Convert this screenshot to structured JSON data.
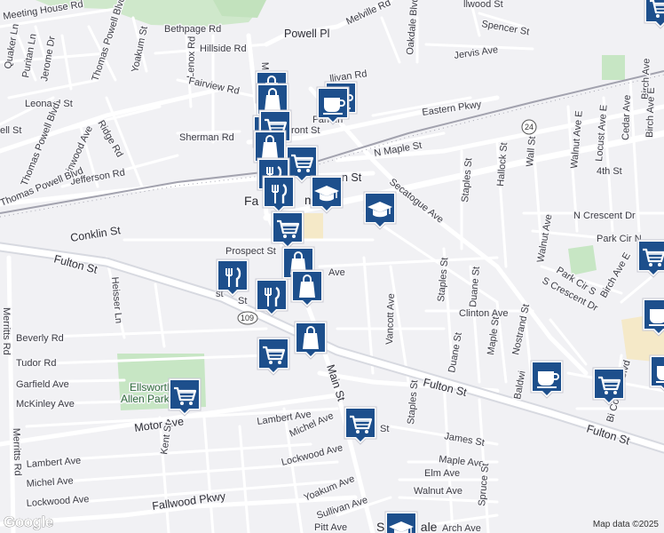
{
  "attribution": "Map data ©2025",
  "logo": "Google",
  "colors": {
    "land": "#f1f1f4",
    "road": "#ffffff",
    "major_road": "#d5d7de",
    "rail": "#9a9aa6",
    "park": "#c7e6c4",
    "marker": "#1d4f8c",
    "school_area": "#f5e9c8"
  },
  "labels": {
    "meeting_house_rd": "Meeting House Rd",
    "bethpage_rd": "Bethpage Rd",
    "powell_pl": "Powell Pl",
    "melville_rd": "Melville Rd",
    "oakdale_blvd": "Oakdale Blvd",
    "spencer_st": "Spencer St",
    "jervis_ave": "Jervis Ave",
    "fallwood_st_top": "llwood St",
    "quaker_ln": "Quaker Ln",
    "puritan_ln": "Puritan Ln",
    "jerome_dr": "Jerome Dr",
    "thomas_powell_blvd_top": "Thomas Powell Blvd",
    "yoakum_st_top": "Yoakum St",
    "lenox_rd": "Lenox Rd",
    "hillside_rd": "Hillside Rd",
    "main_top": "Main",
    "fairview_rd": "Fairview Rd",
    "sullivan_rd": "llivan Rd",
    "leonard_st": "Leonard St",
    "well_st": "ell St",
    "linwood_ave": "Linwood Ave",
    "ridge_rd": "Ridge Rd",
    "thomas_powell_blvd_left": "Thomas Powell Blvd",
    "sherman_rd": "Sherman Rd",
    "jefferson_rd": "Jefferson Rd",
    "thomas_powell_blvd_low": "Thomas Powell Blvd",
    "farmingdale_station": "Farmin",
    "front_st": "ront St",
    "eastern_pkwy": "Eastern Pkwy",
    "n_maple_st": "N Maple St",
    "route_24": "24",
    "birch_ave_top": "Birch Ave",
    "cedar_ave": "Cedar Ave",
    "walnut_ave_e": "Walnut Ave E",
    "locust_ave_e": "Locust Ave E",
    "birch_ave_e_top": "Birch Ave E",
    "fourth_st": "4th St",
    "wall_st": "Wall St",
    "hallock_st": "Hallock St",
    "staples_st_mid": "Staples St",
    "secatogue_ave": "Secatogue Ave",
    "main_st_crossing": "n St",
    "town_name": "Fa",
    "town_name_right": "ma",
    "conklin_st": "Conklin St",
    "n_crescent_dr": "N Crescent Dr",
    "park_cir_n": "Park Cir N",
    "walnut_ave": "Walnut Ave",
    "park_cir_s": "Park Cir S",
    "birch_ave_e": "Birch Ave E",
    "s_crescent_dr": "S Crescent Dr",
    "prospect_st": "Prospect St",
    "ave_mid": "Ave",
    "staples_st_low": "Staples St",
    "duane_st_top": "Duane St",
    "fulton_st_left": "Fulton St",
    "merritts_rd_left": "Merritts Rd",
    "heisser_ln": "Heisser Ln",
    "st_left": "st",
    "st_small": "St",
    "route_109": "109",
    "vancott_ave": "Vancott Ave",
    "clinton_ave": "Clinton Ave",
    "nostrand_st": "Nostrand St",
    "maple_st": "Maple St",
    "duane_st": "Duane St",
    "beverly_rd": "Beverly Rd",
    "tudor_rd": "Tudor Rd",
    "garfield_ave": "Garfield Ave",
    "mckinley_ave": "McKinley Ave",
    "park_name_1": "Ellsworth",
    "park_name_2": "Allen Park",
    "main_st_low": "Main St",
    "fulton_st_mid": "Fulton St",
    "staples_st_bottom": "Staples St",
    "baldwin_st": "Baldwi",
    "bi_county_blvd": "Bi County Blvd",
    "motor_ave": "Motor Ave",
    "lambert_ave_top": "Lambert Ave",
    "kent_st": "Kent St",
    "michel_ave_mid": "Michel Ave",
    "lockwood_ave_mid": "Lockwood Ave",
    "st_after_pin": "St",
    "james_st": "James St",
    "fulton_st_right": "Fulton St",
    "lambert_ave": "Lambert Ave",
    "michel_ave": "Michel Ave",
    "lockwood_ave": "Lockwood Ave",
    "maple_ave": "Maple Ave",
    "elm_ave": "Elm Ave",
    "walnut_ave_low": "Walnut Ave",
    "spruce_st": "Spruce St",
    "yoakum_ave": "Yoakum Ave",
    "fallwood_pkwy": "Fallwood Pkwy",
    "sullivan_ave": "Sullivan Ave",
    "merritts_rd": "Merritts Rd",
    "pitt_ave": "Pitt Ave",
    "arch_ave": "Arch Ave",
    "town_bottom": "S      Farm   ale"
  },
  "markers": [
    {
      "icon": "shopping-bag-icon"
    },
    {
      "icon": "shopping-bag-icon"
    },
    {
      "icon": "coffee-icon"
    },
    {
      "icon": "shopping-bag-icon"
    },
    {
      "icon": "coffee-icon"
    },
    {
      "icon": "cart-icon"
    },
    {
      "icon": "shopping-bag-icon"
    },
    {
      "icon": "cart-icon"
    },
    {
      "icon": "restaurant-icon"
    },
    {
      "icon": "school-icon"
    },
    {
      "icon": "restaurant-icon"
    },
    {
      "icon": "school-icon"
    },
    {
      "icon": "cart-icon"
    },
    {
      "icon": "shopping-bag-icon"
    },
    {
      "icon": "restaurant-icon"
    },
    {
      "icon": "shopping-bag-icon"
    },
    {
      "icon": "restaurant-icon"
    },
    {
      "icon": "shopping-bag-icon"
    },
    {
      "icon": "cart-icon"
    },
    {
      "icon": "cart-icon"
    },
    {
      "icon": "cart-icon"
    },
    {
      "icon": "coffee-icon"
    },
    {
      "icon": "cart-icon"
    },
    {
      "icon": "cart-icon"
    },
    {
      "icon": "coffee-icon"
    },
    {
      "icon": "coffee-icon"
    },
    {
      "icon": "school-icon"
    },
    {
      "icon": "cart-icon"
    }
  ]
}
